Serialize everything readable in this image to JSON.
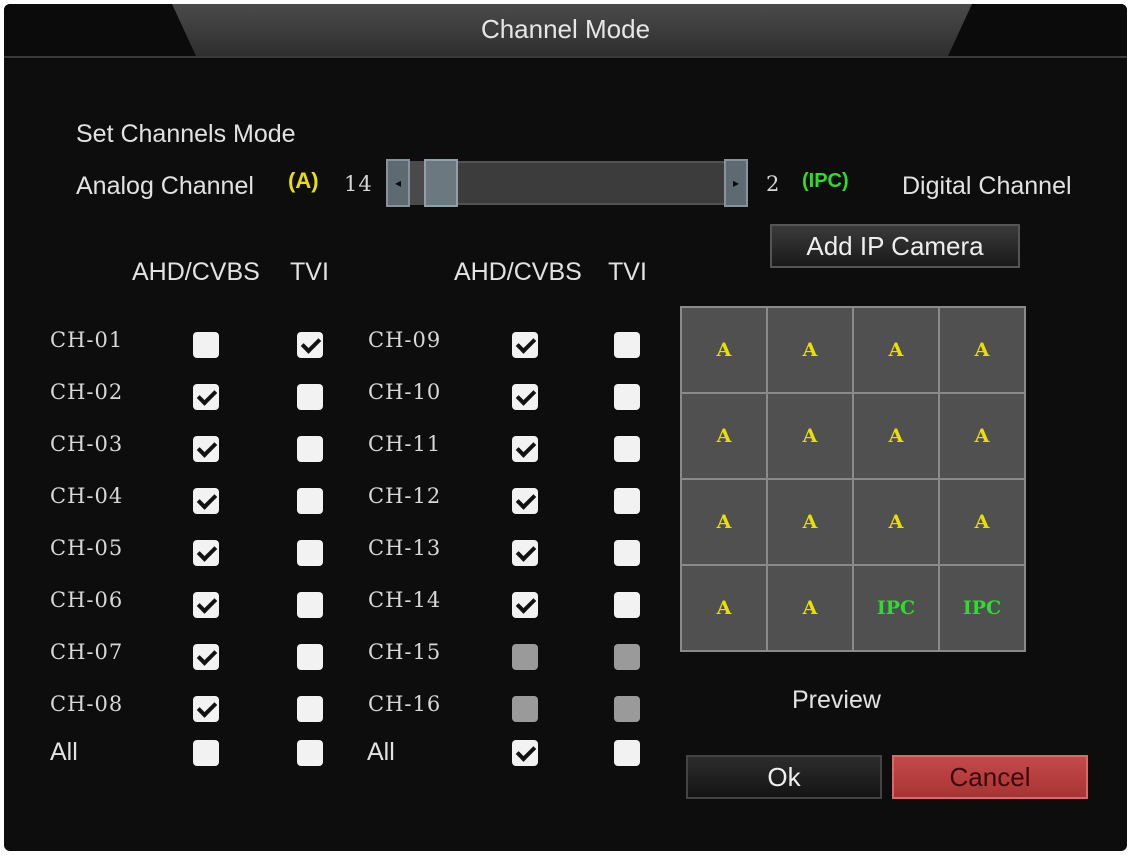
{
  "title": "Channel Mode",
  "set_mode_label": "Set Channels Mode",
  "analog": {
    "label": "Analog Channel",
    "tag": "(A)",
    "count": "14"
  },
  "digital": {
    "count": "2",
    "tag": "(IPC)",
    "label": "Digital Channel"
  },
  "slider": {
    "analog_fraction": 0.875,
    "left_arrow": "◂",
    "right_arrow": "▸"
  },
  "add_ip_camera": "Add IP Camera",
  "headers": {
    "ahd": "AHD/CVBS",
    "tvi": "TVI"
  },
  "left_channels": [
    {
      "name": "CH-01",
      "ahd": false,
      "tvi": true
    },
    {
      "name": "CH-02",
      "ahd": true,
      "tvi": false
    },
    {
      "name": "CH-03",
      "ahd": true,
      "tvi": false
    },
    {
      "name": "CH-04",
      "ahd": true,
      "tvi": false
    },
    {
      "name": "CH-05",
      "ahd": true,
      "tvi": false
    },
    {
      "name": "CH-06",
      "ahd": true,
      "tvi": false
    },
    {
      "name": "CH-07",
      "ahd": true,
      "tvi": false
    },
    {
      "name": "CH-08",
      "ahd": true,
      "tvi": false
    }
  ],
  "right_channels": [
    {
      "name": "CH-09",
      "ahd": true,
      "tvi": false
    },
    {
      "name": "CH-10",
      "ahd": true,
      "tvi": false
    },
    {
      "name": "CH-11",
      "ahd": true,
      "tvi": false
    },
    {
      "name": "CH-12",
      "ahd": true,
      "tvi": false
    },
    {
      "name": "CH-13",
      "ahd": true,
      "tvi": false
    },
    {
      "name": "CH-14",
      "ahd": true,
      "tvi": false
    },
    {
      "name": "CH-15",
      "ahd": false,
      "tvi": false,
      "disabled": true
    },
    {
      "name": "CH-16",
      "ahd": false,
      "tvi": false,
      "disabled": true
    }
  ],
  "all_left": {
    "label": "All",
    "ahd": false,
    "tvi": false
  },
  "all_right": {
    "label": "All",
    "ahd": true,
    "tvi": false
  },
  "preview_grid": [
    "A",
    "A",
    "A",
    "A",
    "A",
    "A",
    "A",
    "A",
    "A",
    "A",
    "A",
    "A",
    "A",
    "A",
    "IPC",
    "IPC"
  ],
  "preview_label": "Preview",
  "ok": "Ok",
  "cancel": "Cancel",
  "colors": {
    "analog": "#e8e000",
    "digital": "#2ddc2d",
    "cancel": "#b93d3d"
  }
}
